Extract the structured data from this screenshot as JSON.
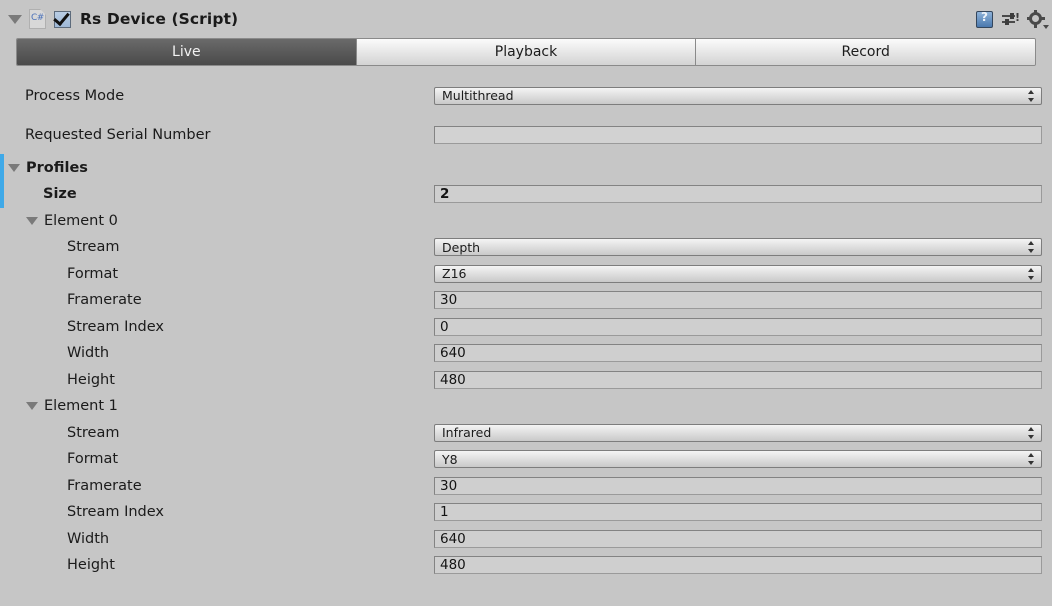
{
  "header": {
    "title": "Rs Device (Script)",
    "foldout_expanded": true,
    "enabled_checkbox": true,
    "script_icon": "csharp-script-icon",
    "icons": [
      "help-icon",
      "preset-icon",
      "gear-icon"
    ]
  },
  "toolbar": {
    "tabs": [
      {
        "label": "Live",
        "active": true
      },
      {
        "label": "Playback",
        "active": false
      },
      {
        "label": "Record",
        "active": false
      }
    ]
  },
  "fields": {
    "process_mode": {
      "label": "Process Mode",
      "value": "Multithread",
      "type": "dropdown"
    },
    "requested_serial_number": {
      "label": "Requested Serial Number",
      "value": "",
      "type": "text"
    }
  },
  "profiles": {
    "label": "Profiles",
    "expanded": true,
    "size_label": "Size",
    "size_value": "2",
    "elements": [
      {
        "label": "Element 0",
        "expanded": true,
        "properties": [
          {
            "label": "Stream",
            "value": "Depth",
            "type": "dropdown"
          },
          {
            "label": "Format",
            "value": "Z16",
            "type": "dropdown"
          },
          {
            "label": "Framerate",
            "value": "30",
            "type": "text"
          },
          {
            "label": "Stream Index",
            "value": "0",
            "type": "text"
          },
          {
            "label": "Width",
            "value": "640",
            "type": "text"
          },
          {
            "label": "Height",
            "value": "480",
            "type": "text"
          }
        ]
      },
      {
        "label": "Element 1",
        "expanded": true,
        "properties": [
          {
            "label": "Stream",
            "value": "Infrared",
            "type": "dropdown"
          },
          {
            "label": "Format",
            "value": "Y8",
            "type": "dropdown"
          },
          {
            "label": "Framerate",
            "value": "30",
            "type": "text"
          },
          {
            "label": "Stream Index",
            "value": "1",
            "type": "text"
          },
          {
            "label": "Width",
            "value": "640",
            "type": "text"
          },
          {
            "label": "Height",
            "value": "480",
            "type": "text"
          }
        ]
      }
    ]
  },
  "colors": {
    "background": "#c6c6c6",
    "selection_accent": "#3fa9e8",
    "active_tab": "#4a4a4a",
    "checkbox": "#9fb9d8"
  }
}
